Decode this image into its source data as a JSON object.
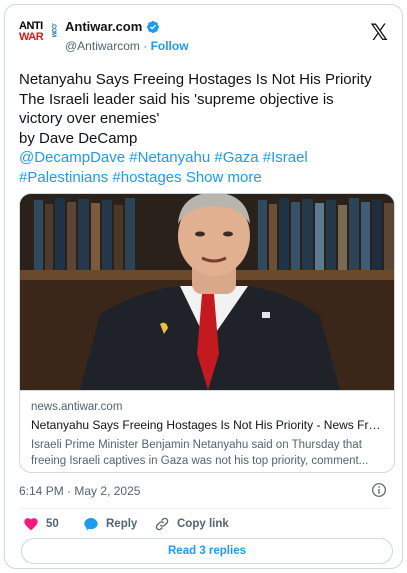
{
  "account": {
    "name": "Antiwar.com",
    "handle": "@Antiwarcom",
    "separator": "·",
    "follow_label": "Follow",
    "logo_line1": "ANTI",
    "logo_line2": "WAR",
    "logo_com": ".COM"
  },
  "tweet": {
    "lines": [
      "Netanyahu Says Freeing Hostages Is Not His Priority",
      "The Israeli leader said his 'supreme objective is",
      "victory over enemies'",
      "by Dave DeCamp"
    ],
    "tags_line1": [
      "@DecampDave",
      "#Netanyahu",
      "#Gaza",
      "#Israel"
    ],
    "tags_line2": [
      "#Palestinians",
      "#hostages"
    ],
    "show_more": "Show more"
  },
  "link_card": {
    "domain": "news.antiwar.com",
    "title": "Netanyahu Says Freeing Hostages Is Not His Priority - News Fro...",
    "desc_line1": "Israeli Prime Minister Benjamin Netanyahu said on Thursday that",
    "desc_line2": "freeing Israeli captives in Gaza was not his top priority, comment..."
  },
  "meta": {
    "time": "6:14 PM",
    "separator": "·",
    "date": "May 2, 2025"
  },
  "actions": {
    "likes": "50",
    "reply_label": "Reply",
    "copy_link_label": "Copy link"
  },
  "read_replies_label": "Read 3 replies",
  "colors": {
    "accent": "#1d9bf0",
    "like": "#f91880",
    "text": "#0f1419",
    "muted": "#536471"
  },
  "icons": [
    "verified-badge-icon",
    "x-logo-icon",
    "info-icon",
    "heart-icon",
    "reply-bubble-icon",
    "link-icon"
  ]
}
